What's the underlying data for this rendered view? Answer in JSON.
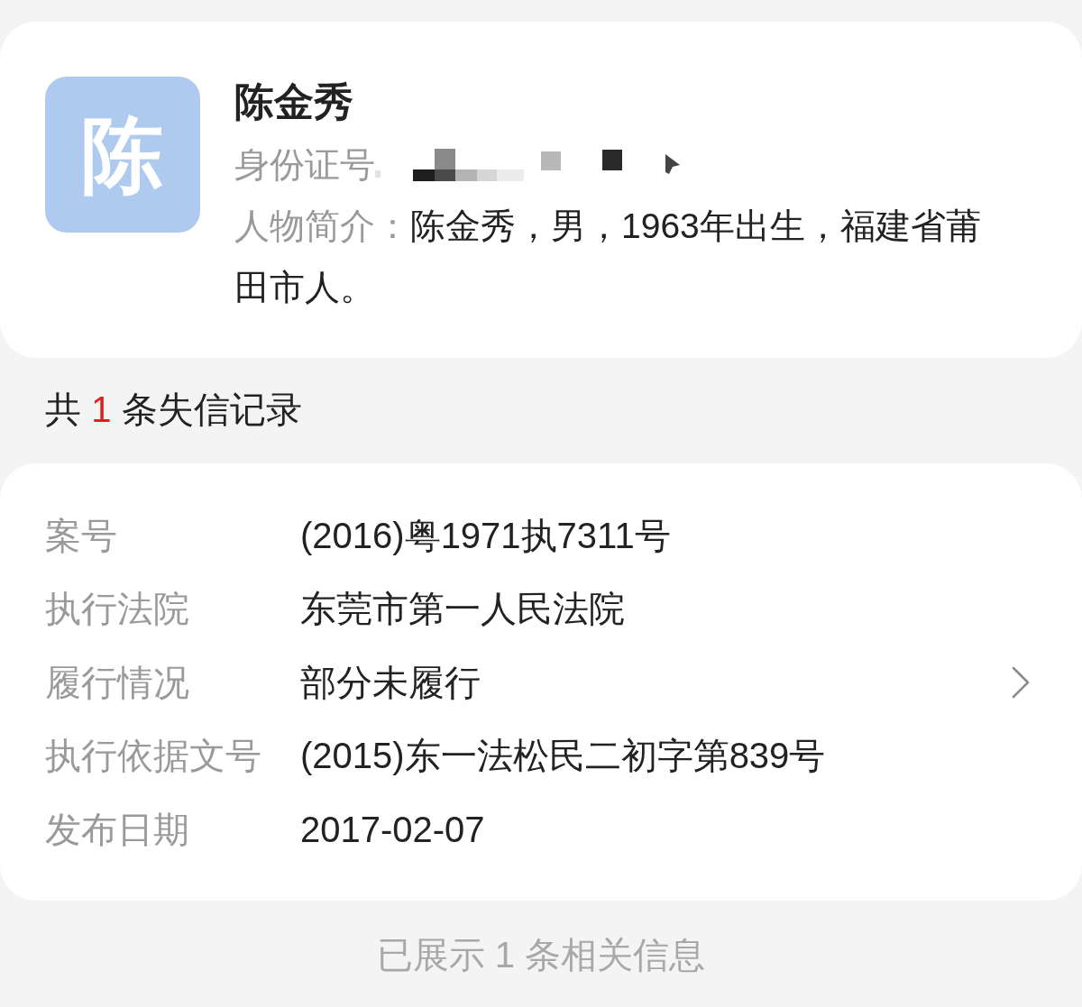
{
  "profile": {
    "avatar_initial": "陈",
    "name": "陈金秀",
    "id_label": "身份证号",
    "intro_label": "人物简介：",
    "intro": "陈金秀，男，1963年出生，福建省莆田市人。"
  },
  "record_summary": {
    "prefix": "共",
    "count": "1",
    "suffix": "条失信记录"
  },
  "record": {
    "rows": [
      {
        "kind": "text",
        "label": "案号",
        "value": "(2016)粤1971执7311号"
      },
      {
        "kind": "text",
        "label": "执行法院",
        "value": "东莞市第一人民法院"
      },
      {
        "kind": "link",
        "label": "履行情况",
        "value": "部分未履行"
      },
      {
        "kind": "text",
        "label": "执行依据文号",
        "value": "(2015)东一法松民二初字第839号"
      },
      {
        "kind": "text",
        "label": "发布日期",
        "value": "2017-02-07"
      }
    ]
  },
  "footer": "已展示 1 条相关信息"
}
